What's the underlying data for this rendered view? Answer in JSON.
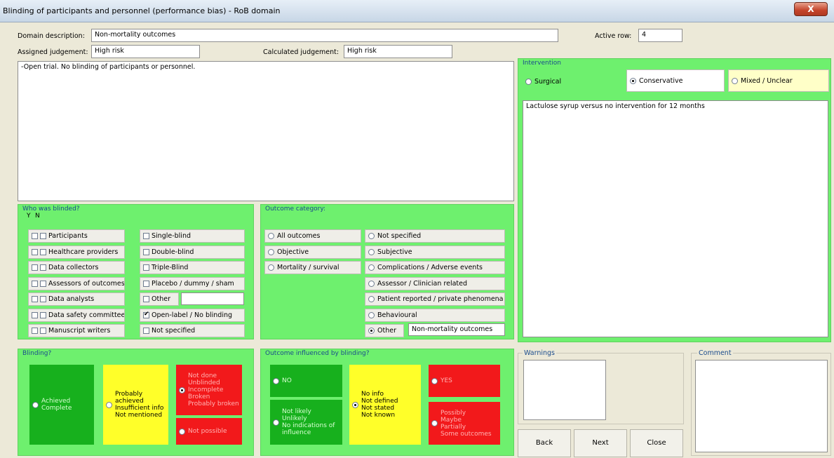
{
  "window": {
    "title": "Blinding of participants and personnel (performance bias) - RoB domain",
    "close_glyph": "X"
  },
  "domain_description": {
    "label": "Domain description:",
    "value": "Non-mortality outcomes"
  },
  "active_row": {
    "label": "Active row:",
    "value": "4"
  },
  "assigned_judgement": {
    "label": "Assigned judgement:",
    "value": "High risk"
  },
  "calculated_judgement": {
    "label": "Calculated judgement:",
    "value": "High risk"
  },
  "notes": {
    "value": "-Open trial. No blinding of participants or personnel."
  },
  "intervention": {
    "title": "Intervention",
    "options": [
      {
        "label": "Surgical",
        "selected": false
      },
      {
        "label": "Conservative",
        "selected": true
      },
      {
        "label": "Mixed / Unclear",
        "selected": false
      }
    ],
    "description": "Lactulose syrup versus no intervention for 12 months"
  },
  "who_blinded": {
    "title": "Who was blinded?",
    "y_label": "Y",
    "n_label": "N",
    "roles": [
      "Participants",
      "Healthcare providers",
      "Data collectors",
      "Assessors of outcomes",
      "Data analysts",
      "Data safety committee",
      "Manuscript writers"
    ],
    "types": [
      {
        "label": "Single-blind",
        "checked": false
      },
      {
        "label": "Double-blind",
        "checked": false
      },
      {
        "label": "Triple-Blind",
        "checked": false
      },
      {
        "label": "Placebo / dummy / sham",
        "checked": false
      },
      {
        "label": "Other",
        "checked": false
      },
      {
        "label": "Open-label / No blinding",
        "checked": true
      },
      {
        "label": "Not specified",
        "checked": false
      }
    ],
    "other_value": ""
  },
  "outcome_category": {
    "title": "Outcome category:",
    "left": [
      "All outcomes",
      "Objective",
      "Mortality / survival"
    ],
    "right": [
      "Not specified",
      "Subjective",
      "Complications / Adverse events",
      "Assessor / Clinician related",
      "Patient reported / private phenomena",
      "Behavioural",
      "Other"
    ],
    "selected": "Other",
    "other_value": "Non-mortality outcomes"
  },
  "blinding": {
    "title": "Blinding?",
    "achieved": "Achieved\nComplete",
    "probably": "Probably\nachieved\nInsufficient info\nNot mentioned",
    "not_done": "Not done\nUnblinded\nIncomplete\nBroken\nProbably broken",
    "not_possible": "Not possible",
    "selected": "not_done"
  },
  "influenced": {
    "title": "Outcome influenced by blinding?",
    "no": "NO",
    "not_likely": "Not likely\nUnlikely\nNo indications of\ninfluence",
    "no_info": "No info\nNot defined\nNot stated\nNot known",
    "yes": "YES",
    "possibly": "Possibly\nMaybe\nPartially\nSome outcomes",
    "selected": "no_info"
  },
  "warnings": {
    "title": "Warnings"
  },
  "comment": {
    "title": "Comment"
  },
  "buttons": {
    "back": "Back",
    "next": "Next",
    "close": "Close"
  },
  "colors": {
    "green_panel": "#6ef06e",
    "dark_green": "#17b01d",
    "yellow": "#ffff29",
    "red": "#f2191b",
    "light_yellow": "#ffffc8"
  }
}
